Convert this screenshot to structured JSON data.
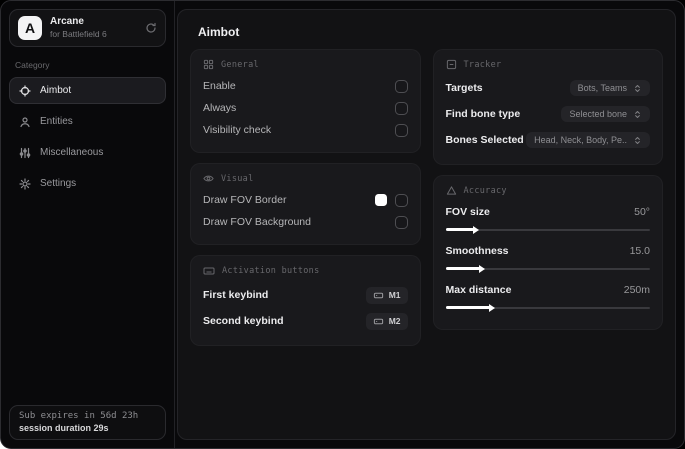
{
  "sidebar": {
    "brand": {
      "logo_letter": "A",
      "name": "Arcane",
      "subtitle": "for Battlefield 6"
    },
    "category_label": "Category",
    "items": [
      {
        "label": "Aimbot",
        "icon": "crosshair-icon",
        "selected": true
      },
      {
        "label": "Entities",
        "icon": "person-icon",
        "selected": false
      },
      {
        "label": "Miscellaneous",
        "icon": "sliders-icon",
        "selected": false
      },
      {
        "label": "Settings",
        "icon": "gear-icon",
        "selected": false
      }
    ],
    "footer": {
      "line1": "Sub expires in 56d 23h",
      "line2": "session duration 29s"
    }
  },
  "main": {
    "title": "Aimbot",
    "cards": {
      "general": {
        "title": "General",
        "icon": "grid-icon",
        "rows": [
          {
            "label": "Enable",
            "checked": false
          },
          {
            "label": "Always",
            "checked": false
          },
          {
            "label": "Visibility check",
            "checked": false
          }
        ]
      },
      "visual": {
        "title": "Visual",
        "icon": "eye-icon",
        "rows": [
          {
            "label": "Draw FOV Border",
            "swatch": "#ffffff",
            "checked": false
          },
          {
            "label": "Draw FOV Background",
            "checked": false
          }
        ]
      },
      "activation": {
        "title": "Activation buttons",
        "icon": "keyboard-icon",
        "rows": [
          {
            "label": "First keybind",
            "key": "M1"
          },
          {
            "label": "Second keybind",
            "key": "M2"
          }
        ]
      },
      "tracker": {
        "title": "Tracker",
        "icon": "tracker-icon",
        "rows": [
          {
            "label": "Targets",
            "value": "Bots, Teams"
          },
          {
            "label": "Find bone type",
            "value": "Selected bone"
          },
          {
            "label": "Bones Selected",
            "value": "Head, Neck, Body, Pe.."
          }
        ]
      },
      "accuracy": {
        "title": "Accuracy",
        "icon": "triangle-icon",
        "rows": [
          {
            "label": "FOV size",
            "value": "50°",
            "fill": "14%"
          },
          {
            "label": "Smoothness",
            "value": "15.0",
            "fill": "17%"
          },
          {
            "label": "Max distance",
            "value": "250m",
            "fill": "22%"
          }
        ]
      }
    }
  },
  "colors": {
    "swatch_fov_border": "#ffffff",
    "slider_fill": "#ffffff",
    "card_bg": "#19191c",
    "panel_bg": "#121214"
  }
}
